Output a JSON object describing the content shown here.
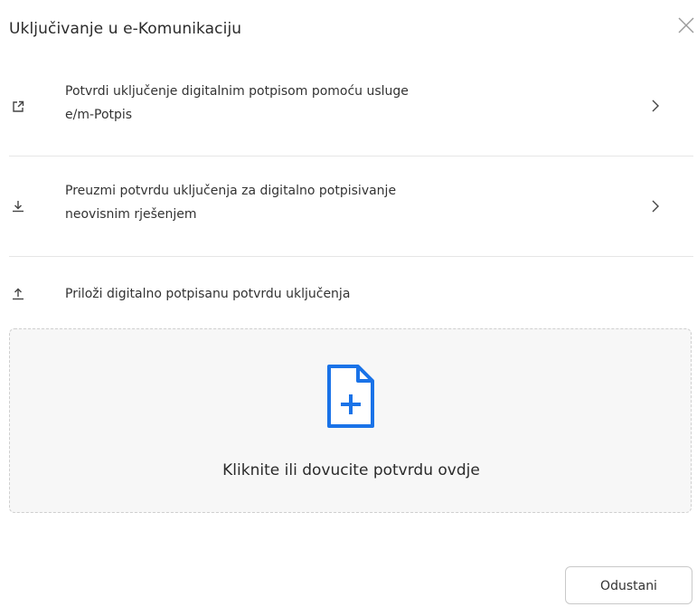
{
  "dialog": {
    "title": "Uključivanje u e-Komunikaciju",
    "close_icon": "close-icon"
  },
  "options": [
    {
      "icon": "external-link-icon",
      "line1": "Potvrdi uključenje digitalnim potpisom pomoću usluge",
      "line2": "e/m-Potpis",
      "chevron": "chevron-right-icon"
    },
    {
      "icon": "download-icon",
      "line1": "Preuzmi potvrdu uključenja za digitalno potpisivanje",
      "line2": "neovisnim rješenjem",
      "chevron": "chevron-right-icon"
    }
  ],
  "upload": {
    "icon": "upload-icon",
    "label": "Priloži digitalno potpisanu potvrdu uključenja",
    "dropzone_icon": "file-add-icon",
    "dropzone_text": "Kliknite ili dovucite potvrdu ovdje"
  },
  "footer": {
    "cancel_label": "Odustani"
  },
  "colors": {
    "accent": "#1a73e8",
    "text": "#2b2b2b",
    "divider": "#e6e6e6",
    "dropzone_bg": "#f7f7f7",
    "dropzone_border": "#cfcfcf"
  }
}
